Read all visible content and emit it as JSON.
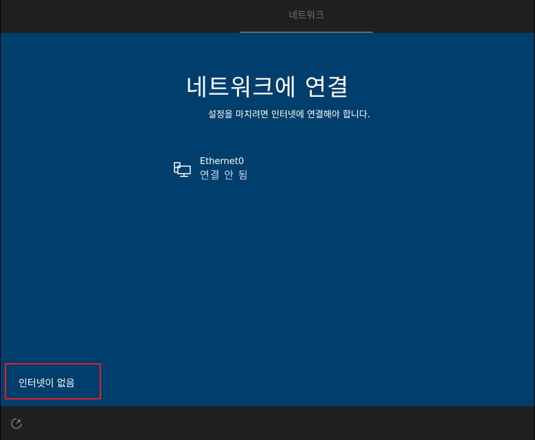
{
  "header": {
    "tab_label": "네트워크"
  },
  "main": {
    "title": "네트워크에 연결",
    "subtitle": "설정을 마치려면 인터넷에 연결해야 합니다."
  },
  "networks": [
    {
      "name": "Ethernet0",
      "status": "연결 안 됨",
      "icon": "ethernet-icon"
    }
  ],
  "footer": {
    "no_internet_label": "인터넷이 없음",
    "accessibility_icon": "ease-of-access-icon"
  },
  "colors": {
    "background": "#003e6e",
    "chrome": "#1f1f1f",
    "highlight": "#e0202a"
  }
}
